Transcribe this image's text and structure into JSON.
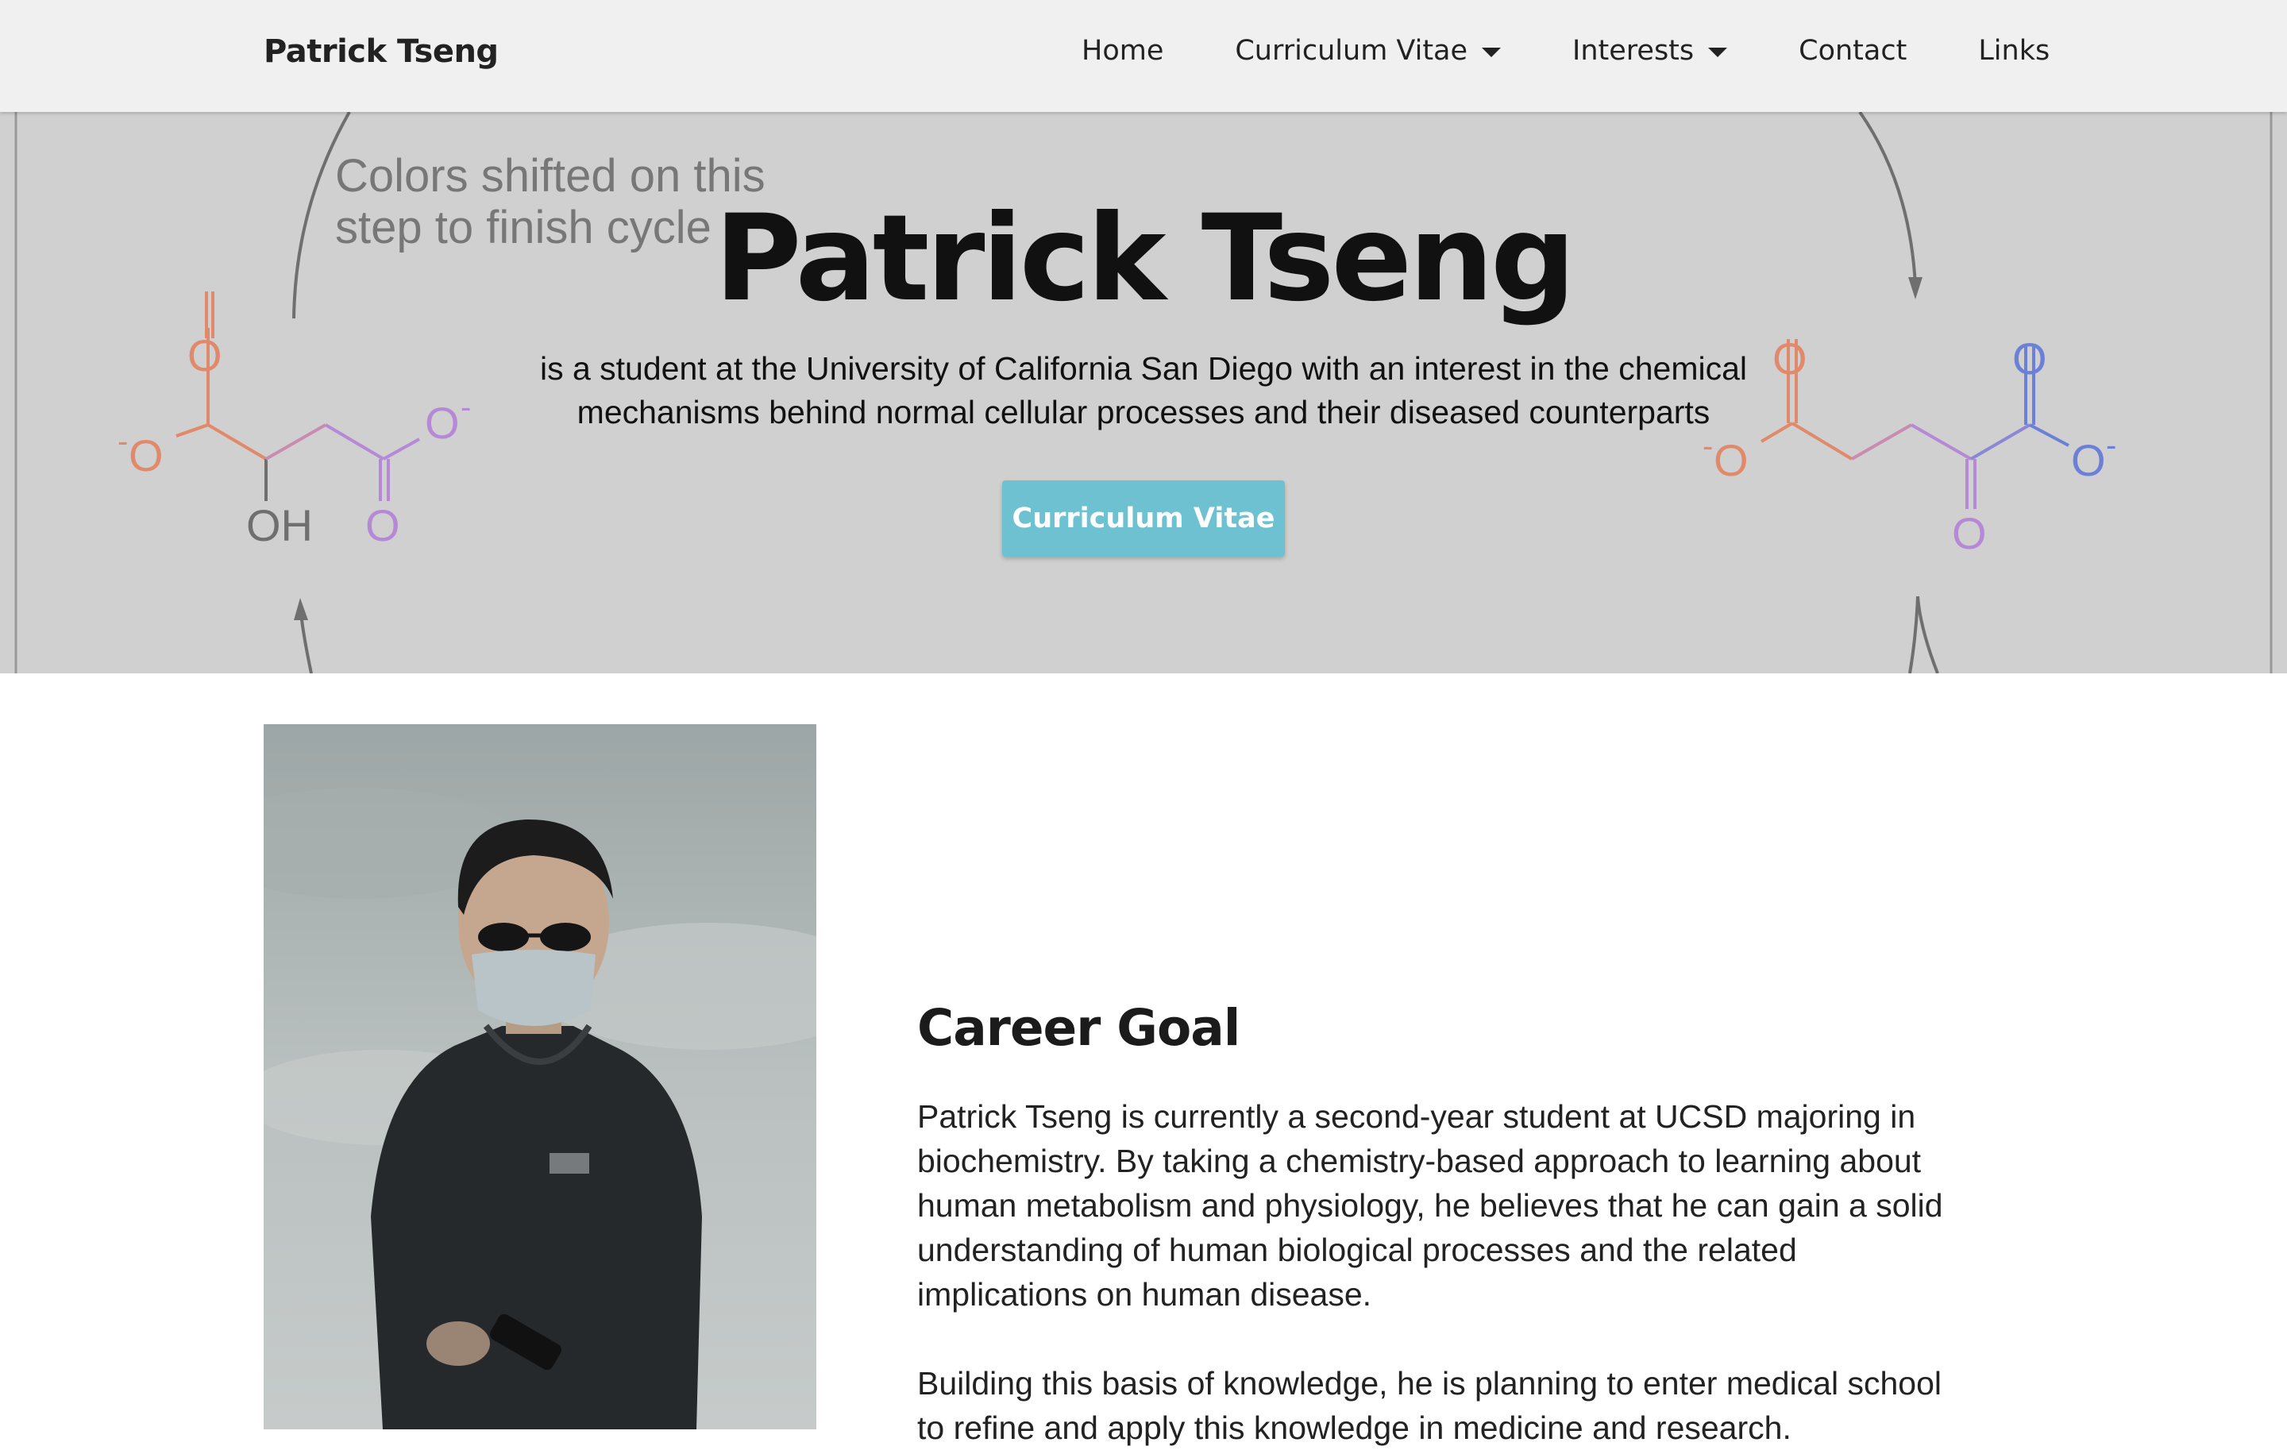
{
  "navbar": {
    "brand": "Patrick Tseng",
    "items": [
      {
        "label": "Home",
        "dropdown": false
      },
      {
        "label": "Curriculum Vitae",
        "dropdown": true
      },
      {
        "label": "Interests",
        "dropdown": true
      },
      {
        "label": "Contact",
        "dropdown": false
      },
      {
        "label": "Links",
        "dropdown": false
      }
    ]
  },
  "hero": {
    "background_note": "Colors shifted on this step to finish cycle",
    "note_line1": "Colors shifted on this",
    "note_line2": "step to finish cycle",
    "left_molecule": {
      "o_top": "O",
      "o_left": "O",
      "oh": "OH",
      "o_bottom": "O",
      "o_right": "O",
      "charge": "-"
    },
    "right_molecule": {
      "o_top_left": "O",
      "o_left": "O",
      "o_bottom": "O",
      "o_top_right": "O",
      "o_right": "O",
      "charge": "-"
    },
    "title": "Patrick Tseng",
    "subtitle": "is a student at the University of California San Diego with an interest in the chemical mechanisms behind normal cellular processes and their diseased counterparts",
    "button_label": "Curriculum Vitae"
  },
  "colors": {
    "navbar_bg": "#f0f0f0",
    "hero_bg": "#d0d0d0",
    "button_bg": "#6ec1d0",
    "orange_atom": "#e0896b",
    "purple_atom": "#b589d6",
    "blue_atom": "#6b80d6"
  },
  "career": {
    "title": "Career Goal",
    "paragraph1": "Patrick Tseng is currently a second-year student at UCSD majoring in biochemistry. By taking a chemistry-based approach to learning about human metabolism and physiology, he believes that he can gain a solid understanding of human biological processes and the related implications on human disease.",
    "paragraph2": "Building this basis of knowledge, he is planning to enter medical school to refine and apply this knowledge in medicine and research."
  }
}
